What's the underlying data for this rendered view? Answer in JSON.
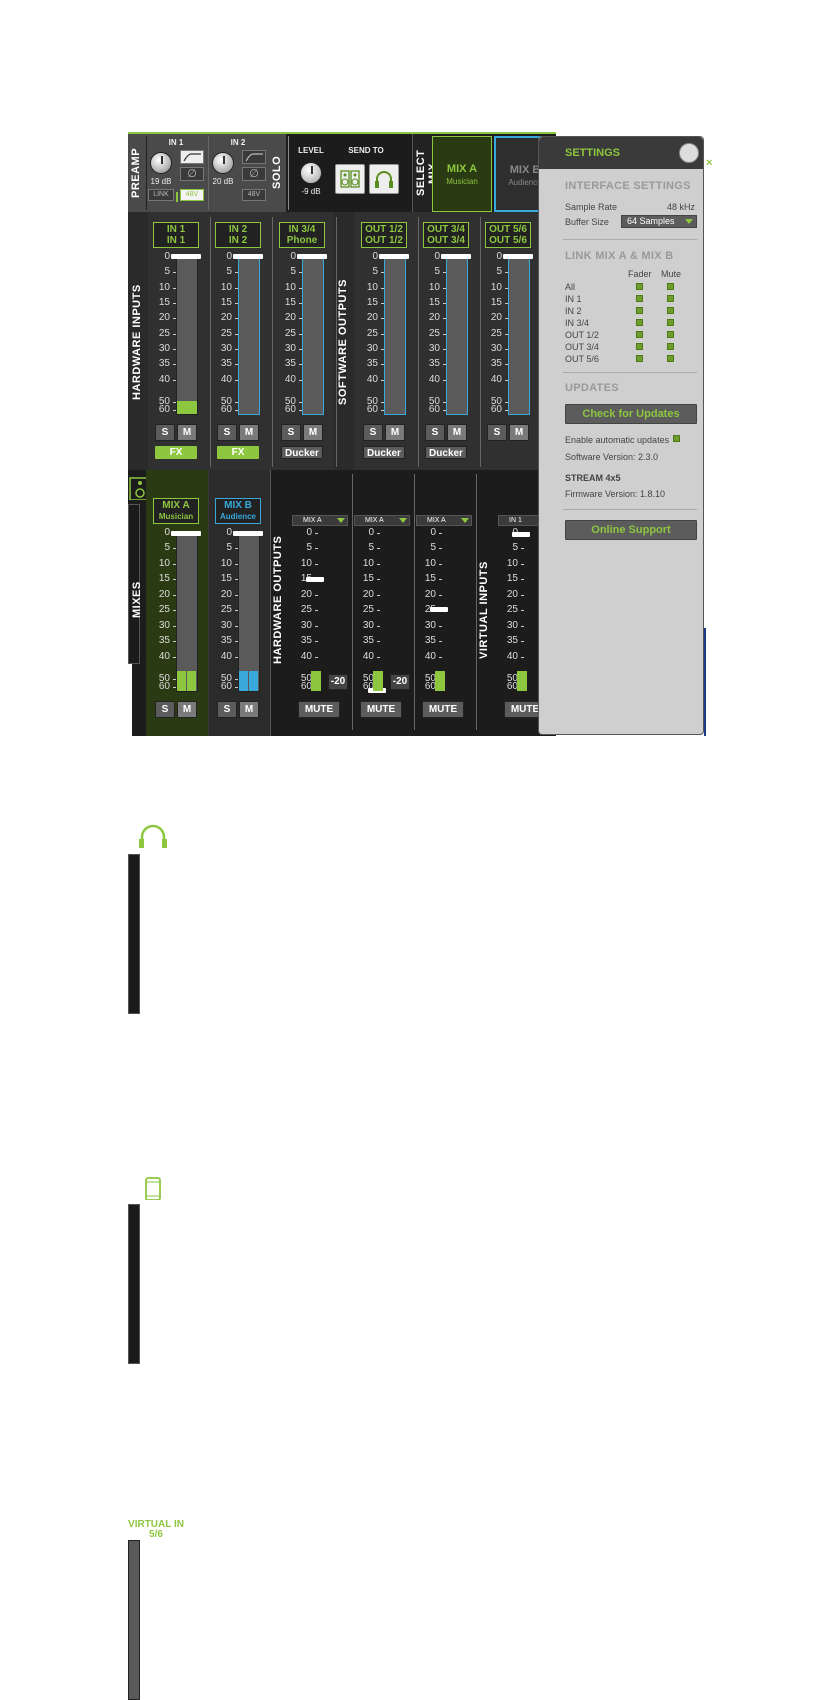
{
  "top": {
    "preamp_label": "PREAMP",
    "in1": {
      "name": "IN 1",
      "gain": "19 dB",
      "link": "LINK",
      "phantom": "48V"
    },
    "in2": {
      "name": "IN 2",
      "gain": "20 dB",
      "phantom": "48V"
    },
    "solo_label": "SOLO",
    "level_label": "LEVEL",
    "level_value": "-9 dB",
    "send_to_label": "SEND TO",
    "select_mix_label": "SELECT MIX",
    "mix_a": {
      "name": "MIX A",
      "sub": "Musician"
    },
    "mix_b": {
      "name": "MIX B",
      "sub": "Audience"
    }
  },
  "scale": [
    "0",
    "5",
    "10",
    "15",
    "20",
    "25",
    "30",
    "35",
    "40",
    "50",
    "60"
  ],
  "inputs_section": {
    "hw_label": "HARDWARE INPUTS",
    "sw_label": "SOFTWARE OUTPUTS",
    "channels": [
      {
        "line1": "IN 1",
        "line2": "IN 1",
        "button": "FX"
      },
      {
        "line1": "IN 2",
        "line2": "IN 2",
        "button": "FX"
      },
      {
        "line1": "IN 3/4",
        "line2": "Phone",
        "button": "Ducker"
      },
      {
        "line1": "OUT 1/2",
        "line2": "OUT 1/2",
        "button": "Ducker"
      },
      {
        "line1": "OUT 3/4",
        "line2": "OUT 3/4",
        "button": "Ducker"
      },
      {
        "line1": "OUT 5/6",
        "line2": "OUT 5/6",
        "button": ""
      }
    ],
    "s_label": "S",
    "m_label": "M"
  },
  "mixes_section": {
    "mixes_label": "MIXES",
    "hw_out_label": "HARDWARE OUTPUTS",
    "virtual_label": "VIRTUAL INPUTS",
    "mix_a": {
      "name": "MIX A",
      "sub": "Musician"
    },
    "mix_b": {
      "name": "MIX B",
      "sub": "Audience"
    },
    "virtual_title": "VIRTUAL IN 5/6",
    "selects": [
      "MIX A",
      "MIX A",
      "MIX A",
      "IN 1"
    ],
    "minus20": "-20",
    "mute_label": "MUTE",
    "fader_levels": [
      0.29,
      1.0,
      0.48,
      0.0
    ]
  },
  "settings": {
    "title": "SETTINGS",
    "interface_heading": "INTERFACE SETTINGS",
    "sample_rate_label": "Sample Rate",
    "sample_rate_value": "48 kHz",
    "buffer_label": "Buffer Size",
    "buffer_value": "64 Samples",
    "link_heading": "LINK MIX A & MIX B",
    "fader_col": "Fader",
    "mute_col": "Mute",
    "link_rows": [
      "All",
      "IN 1",
      "IN 2",
      "IN 3/4",
      "OUT 1/2",
      "OUT 3/4",
      "OUT 5/6"
    ],
    "updates_heading": "UPDATES",
    "check_updates": "Check for Updates",
    "auto_updates": "Enable automatic updates",
    "software_version": "Software Version: 2.3.0",
    "device_name": "STREAM 4x5",
    "firmware_version": "Firmware Version: 1.8.10",
    "online_support": "Online Support"
  },
  "colors": {
    "accent": "#8dc63f",
    "blue": "#39a9dc"
  }
}
